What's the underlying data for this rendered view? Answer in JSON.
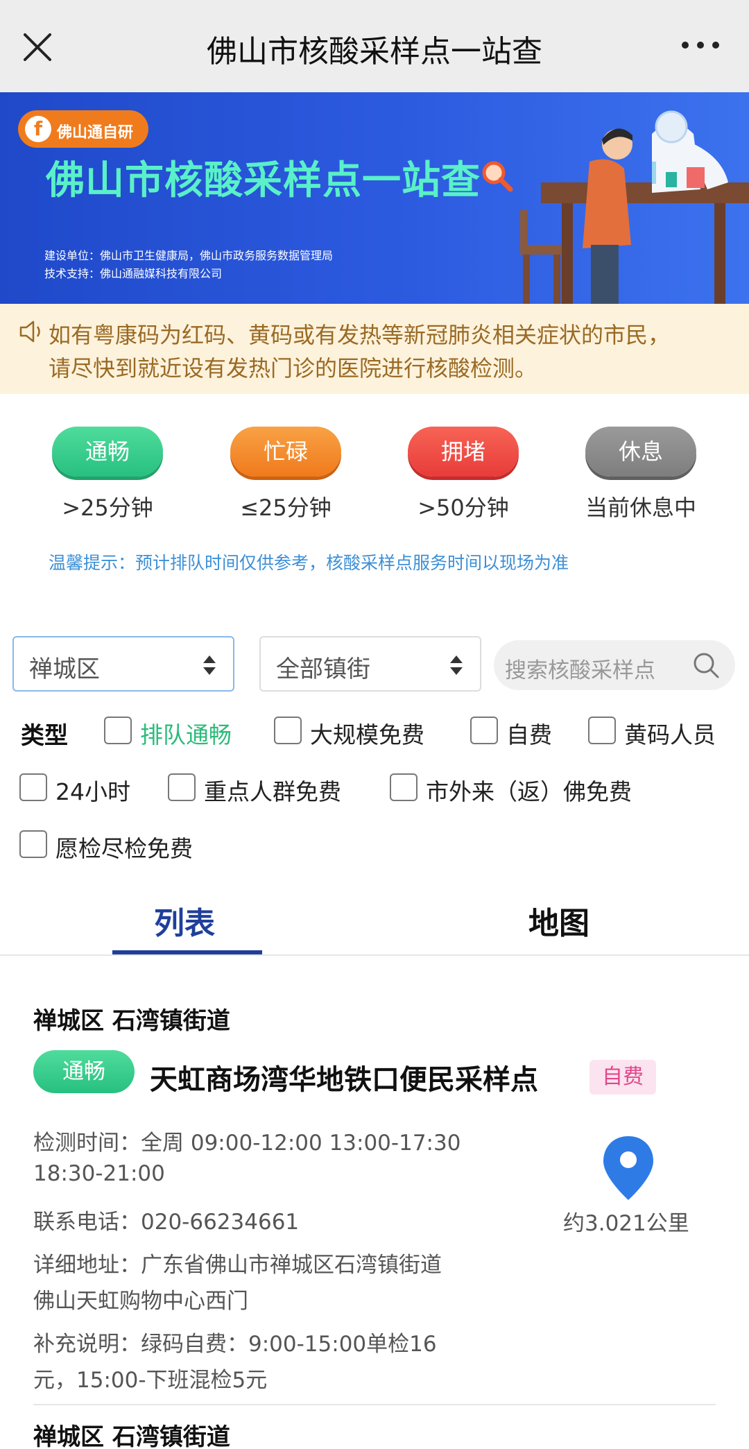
{
  "topbar": {
    "title": "佛山市核酸采样点一站查",
    "close_icon": "close-icon",
    "more_icon": "more-dots-icon"
  },
  "banner": {
    "badge": "佛山通自研",
    "title": "佛山市核酸采样点一站查",
    "line1": "建设单位：佛山市卫生健康局，佛山市政务服务数据管理局",
    "line2": "技术支持：佛山通融媒科技有限公司"
  },
  "notice": {
    "line1": "如有粤康码为红码、黄码或有发热等新冠肺炎相关症状的市民，",
    "line2": "请尽快到就近设有发热门诊的医院进行核酸检测。"
  },
  "legend": [
    {
      "status": "通畅",
      "desc": ">25分钟",
      "color": "#27c080"
    },
    {
      "status": "忙碌",
      "desc": "≤25分钟",
      "color": "#f07a1c"
    },
    {
      "status": "拥堵",
      "desc": ">50分钟",
      "color": "#e83c3a"
    },
    {
      "status": "休息",
      "desc": "当前休息中",
      "color": "#7e7e7e"
    }
  ],
  "tip": "温馨提示：预计排队时间仅供参考，核酸采样点服务时间以现场为准",
  "filters": {
    "district": "禅城区",
    "street": "全部镇街",
    "search_placeholder": "搜索核酸采样点",
    "type_label": "类型",
    "types": [
      "排队通畅",
      "大规模免费",
      "自费",
      "黄码人员",
      "24小时",
      "重点人群免费",
      "市外来（返）佛免费",
      "愿检尽检免费"
    ]
  },
  "tabs": {
    "list": "列表",
    "map": "地图"
  },
  "sites": [
    {
      "area": "禅城区 石湾镇街道",
      "status": "通畅",
      "name": "天虹商场湾华地铁口便民采样点",
      "fee": "自费",
      "time_line1": "检测时间：全周 09:00-12:00 13:00-17:30",
      "time_line2": "18:30-21:00",
      "phone": "联系电话：020-66234661",
      "addr_line1": "详细地址：广东省佛山市禅城区石湾镇街道",
      "addr_line2": "佛山天虹购物中心西门",
      "note_line1": "补充说明：绿码自费：9:00-15:00单检16",
      "note_line2": "元，15:00-下班混检5元",
      "distance": "约3.021公里"
    },
    {
      "area": "禅城区 石湾镇街道"
    }
  ]
}
